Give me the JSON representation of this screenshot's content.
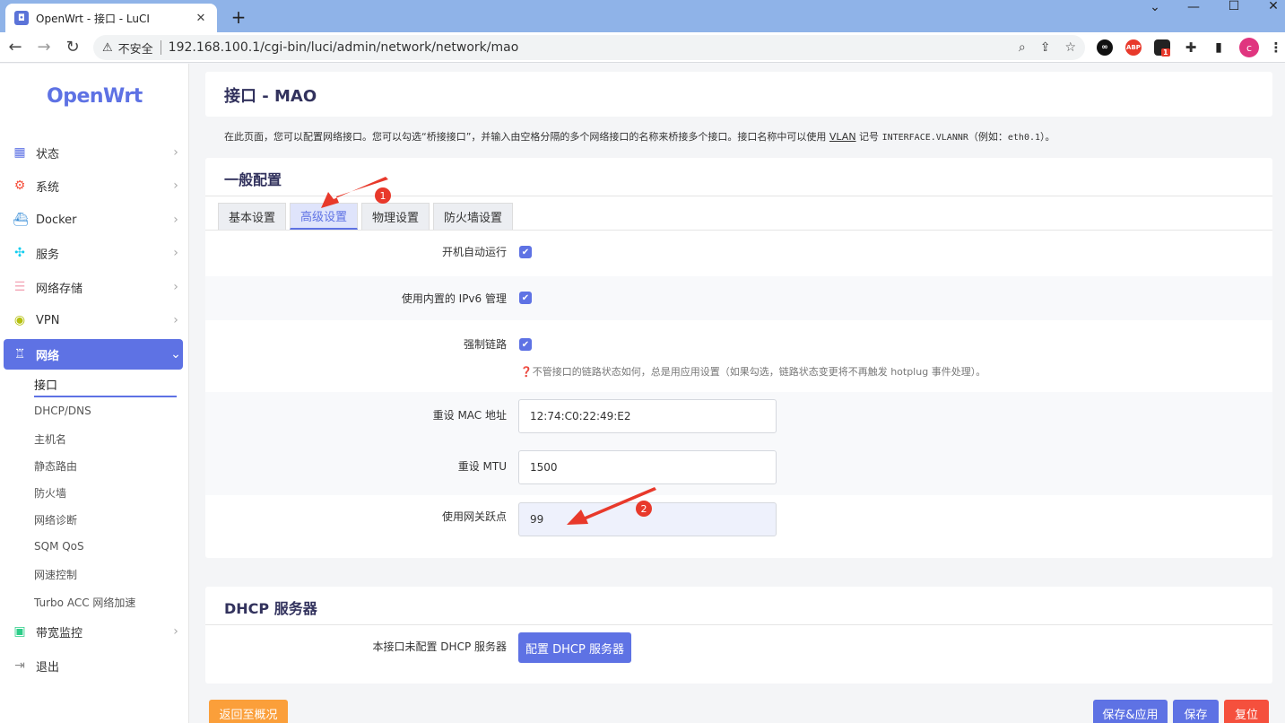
{
  "browser": {
    "tab_title": "OpenWrt - 接口 - LuCI",
    "insecure_label": "不安全",
    "url": "192.168.100.1/cgi-bin/luci/admin/network/network/mao",
    "profile_initial": "c",
    "ext_badge": "1",
    "abp_label": "ABP"
  },
  "sidebar": {
    "logo": "OpenWrt",
    "items": [
      {
        "label": "状态",
        "icon": "dashboard-icon"
      },
      {
        "label": "系统",
        "icon": "gear-icon"
      },
      {
        "label": "Docker",
        "icon": "docker-icon"
      },
      {
        "label": "服务",
        "icon": "puzzle-icon"
      },
      {
        "label": "网络存储",
        "icon": "database-icon"
      },
      {
        "label": "VPN",
        "icon": "vpn-icon"
      },
      {
        "label": "网络",
        "icon": "sitemap-icon"
      },
      {
        "label": "带宽监控",
        "icon": "monitor-icon"
      },
      {
        "label": "退出",
        "icon": "logout-icon"
      }
    ],
    "network_sub": [
      "接口",
      "DHCP/DNS",
      "主机名",
      "静态路由",
      "防火墙",
      "网络诊断",
      "SQM QoS",
      "网速控制",
      "Turbo ACC 网络加速"
    ]
  },
  "page": {
    "title": "接口 - MAO",
    "desc_a": "在此页面，您可以配置网络接口。您可以勾选“桥接接口”，并输入由空格分隔的多个网络接口的名称来桥接多个接口。接口名称中可以使用 ",
    "desc_vlan": "VLAN",
    "desc_b": " 记号 ",
    "desc_mono": "INTERFACE.VLANNR",
    "desc_c": "（例如：",
    "desc_mono2": "eth0.1",
    "desc_d": "）。"
  },
  "general": {
    "title": "一般配置",
    "tabs": [
      "基本设置",
      "高级设置",
      "物理设置",
      "防火墙设置"
    ],
    "fields": {
      "autostart_label": "开机自动运行",
      "ipv6_label": "使用内置的 IPv6 管理",
      "force_link_label": "强制链路",
      "force_link_hint": "❓不管接口的链路状态如何，总是用应用设置（如果勾选，链路状态变更将不再触发 hotplug 事件处理）。",
      "mac_label": "重设 MAC 地址",
      "mac_value": "12:74:C0:22:49:E2",
      "mtu_label": "重设 MTU",
      "mtu_value": "1500",
      "metric_label": "使用网关跃点",
      "metric_value": "99"
    }
  },
  "dhcp": {
    "title": "DHCP 服务器",
    "label": "本接口未配置 DHCP 服务器",
    "button": "配置 DHCP 服务器"
  },
  "footer": {
    "back": "返回至概况",
    "save_apply": "保存&应用",
    "save": "保存",
    "reset": "复位"
  },
  "annotations": {
    "badge1": "1",
    "badge2": "2"
  },
  "colors": {
    "accent": "#5e72e4",
    "back_btn": "#fb9f3a",
    "reset_btn": "#f5503d",
    "annotation": "#e8392b"
  }
}
